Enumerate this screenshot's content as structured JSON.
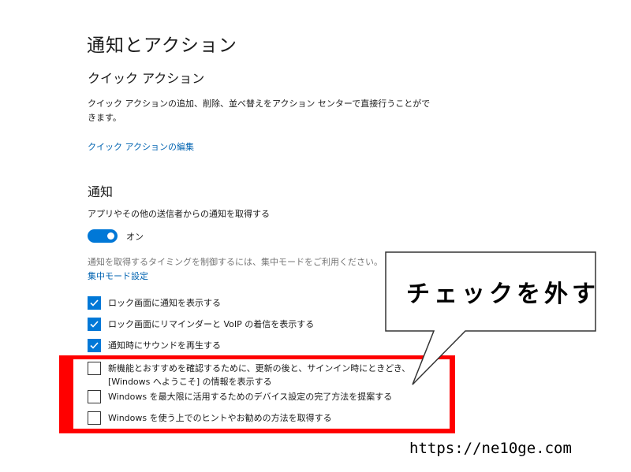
{
  "page_title": "通知とアクション",
  "quick_actions": {
    "heading": "クイック アクション",
    "description_line1": "クイック アクションの追加、削除、並べ替えをアクション センターで直接行うことがで",
    "description_line2": "きます。",
    "edit_link": "クイック アクションの編集"
  },
  "notifications": {
    "heading": "通知",
    "get_notifications_label": "アプリやその他の送信者からの通知を取得する",
    "toggle_state": "オン",
    "toggle_on": true,
    "focus_hint": "通知を取得するタイミングを制御するには、集中モードをご利用ください。",
    "focus_link": "集中モード設定",
    "options": [
      {
        "label": "ロック画面に通知を表示する",
        "checked": true
      },
      {
        "label": "ロック画面にリマインダーと VoIP の着信を表示する",
        "checked": true
      },
      {
        "label": "通知時にサウンドを再生する",
        "checked": true
      },
      {
        "label": "新機能とおすすめを確認するために、更新の後と、サインイン時にときどき、",
        "label2": "[Windows へようこそ] の情報を表示する",
        "checked": false
      },
      {
        "label": "Windows を最大限に活用するためのデバイス設定の完了方法を提案する",
        "checked": false
      },
      {
        "label": "Windows を使う上でのヒントやお勧めの方法を取得する",
        "checked": false
      }
    ]
  },
  "annotation": {
    "callout_text": "チェックを外す",
    "highlight_color": "#ff0000",
    "site_url": "https://ne10ge.com"
  },
  "colors": {
    "accent": "#0078d7",
    "link": "#0063b1"
  }
}
